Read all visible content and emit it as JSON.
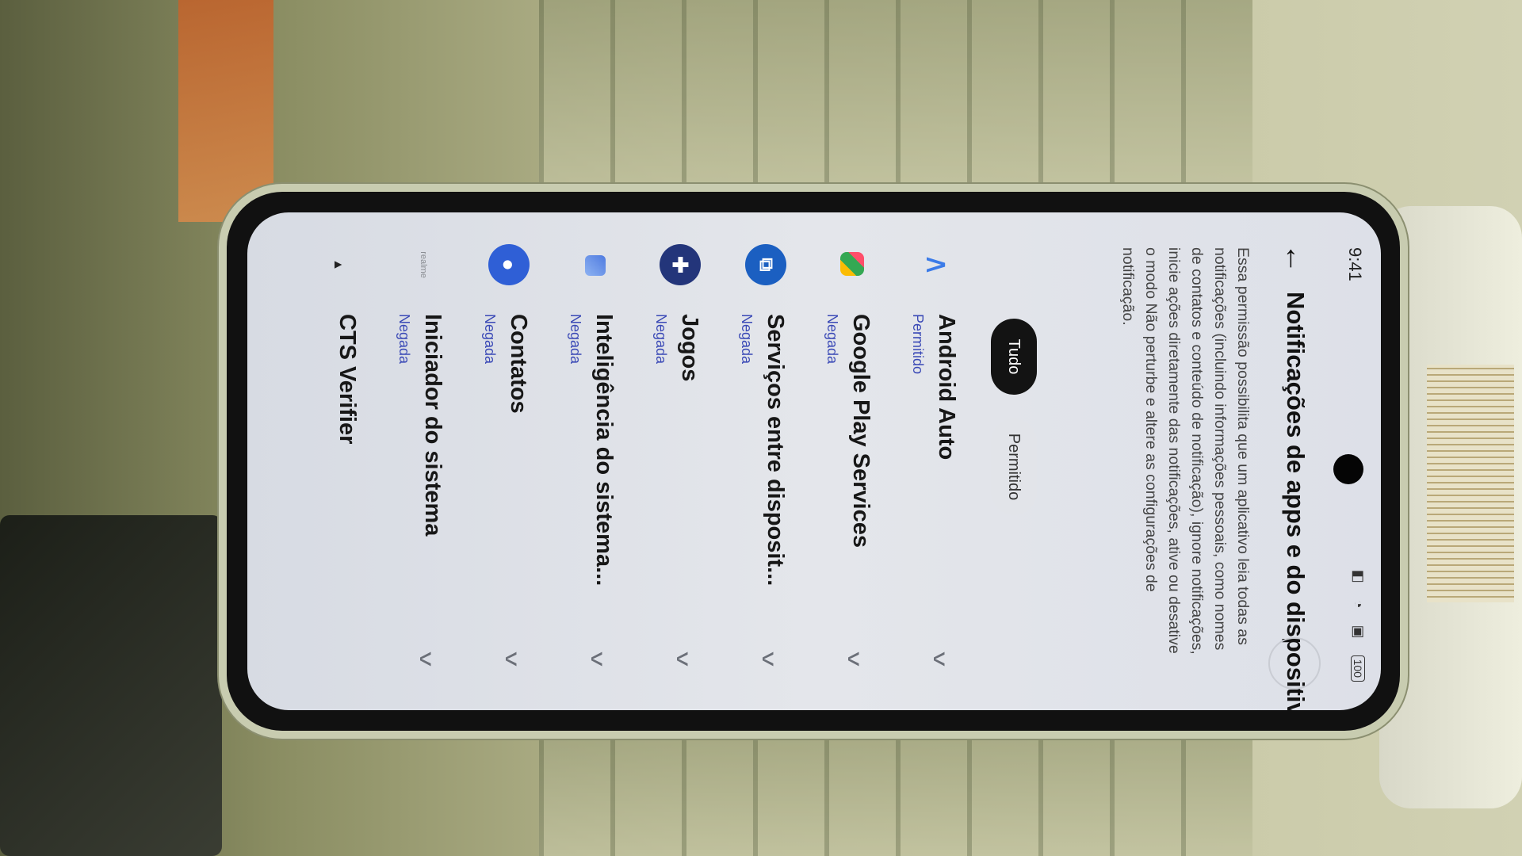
{
  "status_bar": {
    "time": "9:41",
    "battery": "100"
  },
  "header": {
    "title": "Notificações de apps e do dispositivo"
  },
  "description": "Essa permissão possibilita que um aplicativo leia todas as notificações (incluindo informações pessoais, como nomes de contatos e conteúdo de notificação), ignore notificações, inicie ações diretamente das notificações, ative ou desative o modo Não perturbe e altere as configurações de notificação.",
  "filters": {
    "all": "Tudo",
    "allowed": "Permitido"
  },
  "apps": [
    {
      "name": "Android Auto",
      "status": "Permitido",
      "icon": "android-auto-icon"
    },
    {
      "name": "Google Play Services",
      "status": "Negada",
      "icon": "google-play-services-icon"
    },
    {
      "name": "Serviços entre disposit...",
      "status": "Negada",
      "icon": "cross-device-services-icon"
    },
    {
      "name": "Jogos",
      "status": "Negada",
      "icon": "games-controller-icon"
    },
    {
      "name": "Inteligência do sistema...",
      "status": "Negada",
      "icon": "system-intelligence-icon"
    },
    {
      "name": "Contatos",
      "status": "Negada",
      "icon": "contacts-icon"
    },
    {
      "name": "Iniciador do sistema",
      "status": "Negada",
      "icon": "system-launcher-icon"
    },
    {
      "name": "CTS Verifier",
      "status": "",
      "icon": "cts-verifier-icon"
    }
  ],
  "icon_glyphs": {
    "back": "←",
    "chevron": "v",
    "auto": "∧",
    "cross": "⧉",
    "games": "✚",
    "contacts": "●",
    "realme": "realme",
    "cts": "▲"
  },
  "colors": {
    "accent": "#3a49b6",
    "chip_active": "#131313"
  }
}
